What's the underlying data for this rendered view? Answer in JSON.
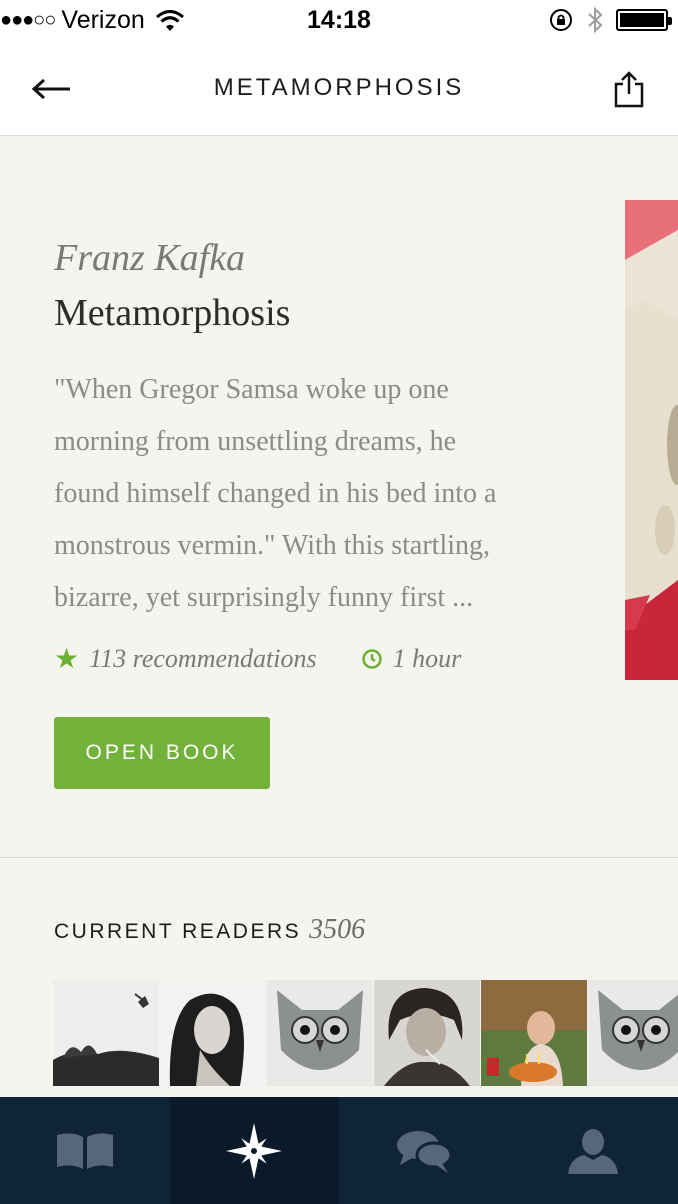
{
  "status_bar": {
    "signal": "●●●○○",
    "carrier": "Verizon",
    "time": "14:18",
    "icons": [
      "wifi-icon",
      "rotation-lock-icon",
      "bluetooth-icon",
      "battery-icon"
    ]
  },
  "nav": {
    "title": "METAMORPHOSIS",
    "back_icon": "back-arrow-icon",
    "share_icon": "share-icon"
  },
  "book": {
    "author": "Franz Kafka",
    "title": "Metamorphosis",
    "description_lines": [
      "\"When Gregor Samsa woke up one",
      "morning from unsettling dreams, he",
      "found himself changed in his bed into a",
      "monstrous vermin.\" With this startling,",
      "bizarre, yet surprisingly funny first ..."
    ],
    "recommendations": "113 recommendations",
    "duration": "1 hour",
    "open_button": "OPEN BOOK"
  },
  "readers": {
    "label": "CURRENT READERS",
    "count": "3506",
    "avatars": [
      "avatar-jumping-figure",
      "avatar-woman-portrait",
      "avatar-owl",
      "avatar-man-smoking",
      "avatar-birthday-cake",
      "avatar-owl"
    ]
  },
  "tabbar": {
    "tabs": [
      "library-tab",
      "discover-tab",
      "chat-tab",
      "profile-tab"
    ],
    "active": "discover-tab"
  },
  "colors": {
    "accent_green": "#72b13a",
    "tabbar_bg": "#0f2436",
    "page_bg": "#f5f4ef"
  }
}
